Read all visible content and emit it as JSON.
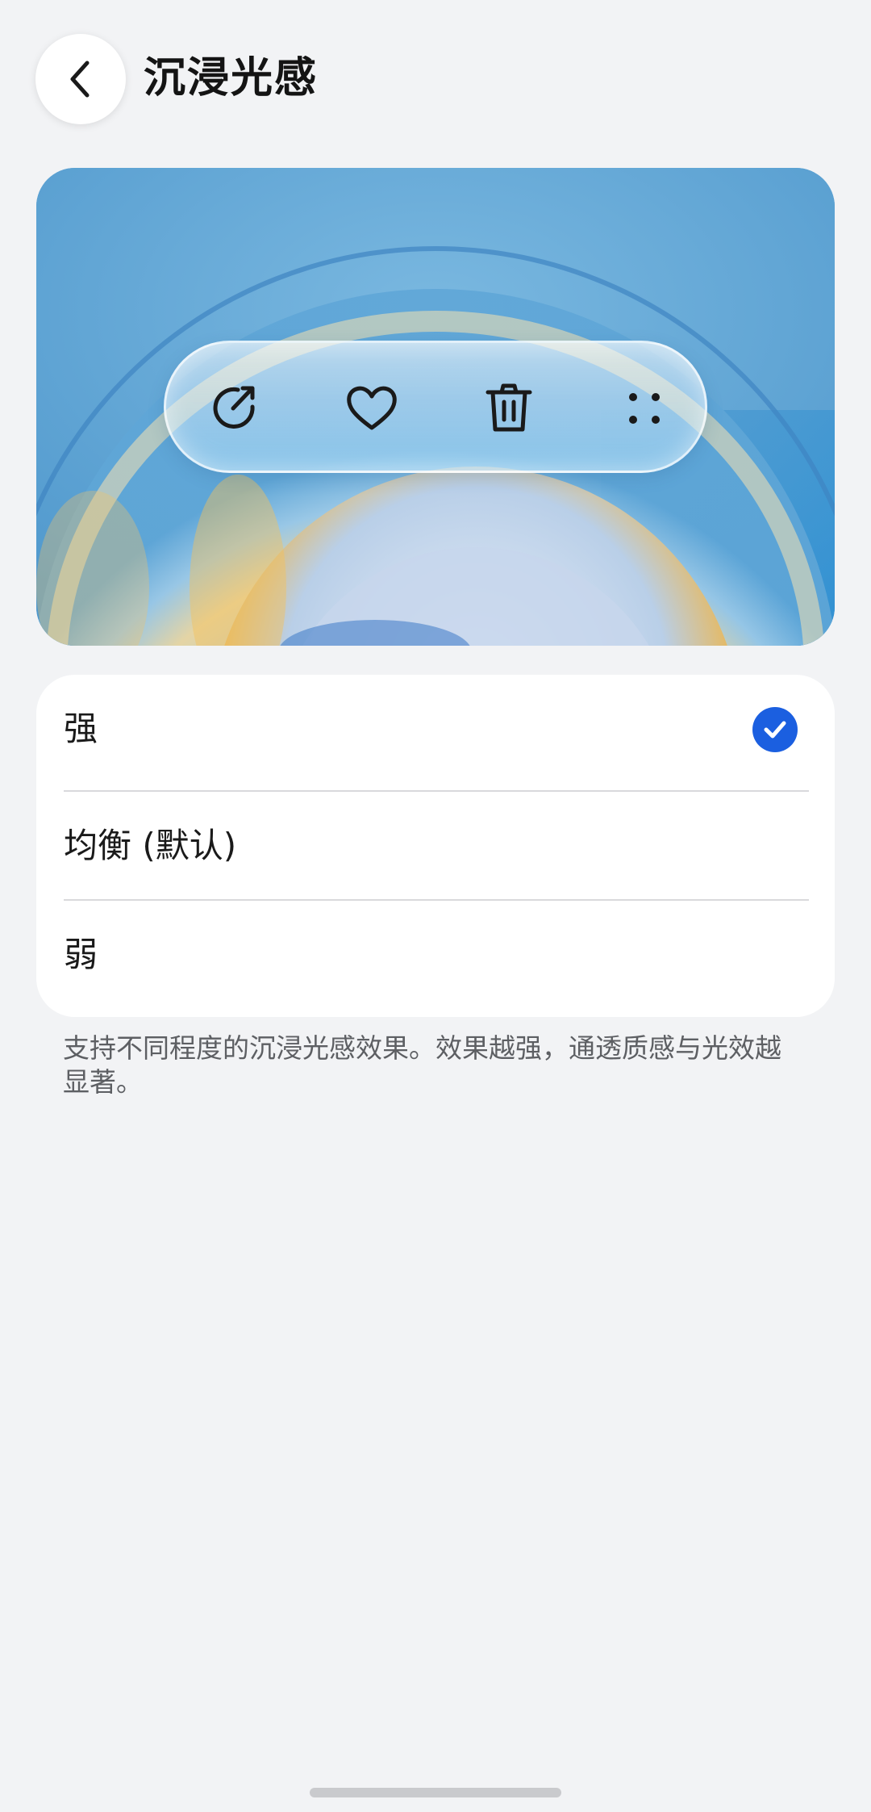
{
  "header": {
    "back_icon": "chevron-left-icon",
    "title": "沉浸光感"
  },
  "preview": {
    "toolbar": [
      {
        "icon": "share-icon"
      },
      {
        "icon": "heart-icon"
      },
      {
        "icon": "trash-icon"
      },
      {
        "icon": "more-dots-icon"
      }
    ],
    "colors": {
      "sky": "#5ea5d6",
      "glow_orange": "#f0b443",
      "accent_blue": "#1f8ed8"
    }
  },
  "options": {
    "items": [
      {
        "label": "强",
        "selected": true
      },
      {
        "label": "均衡 (默认)",
        "selected": false
      },
      {
        "label": "弱",
        "selected": false
      }
    ],
    "check_color": "#1b5fe0"
  },
  "description": "支持不同程度的沉浸光感效果。效果越强，通透质感与光效越显著。"
}
